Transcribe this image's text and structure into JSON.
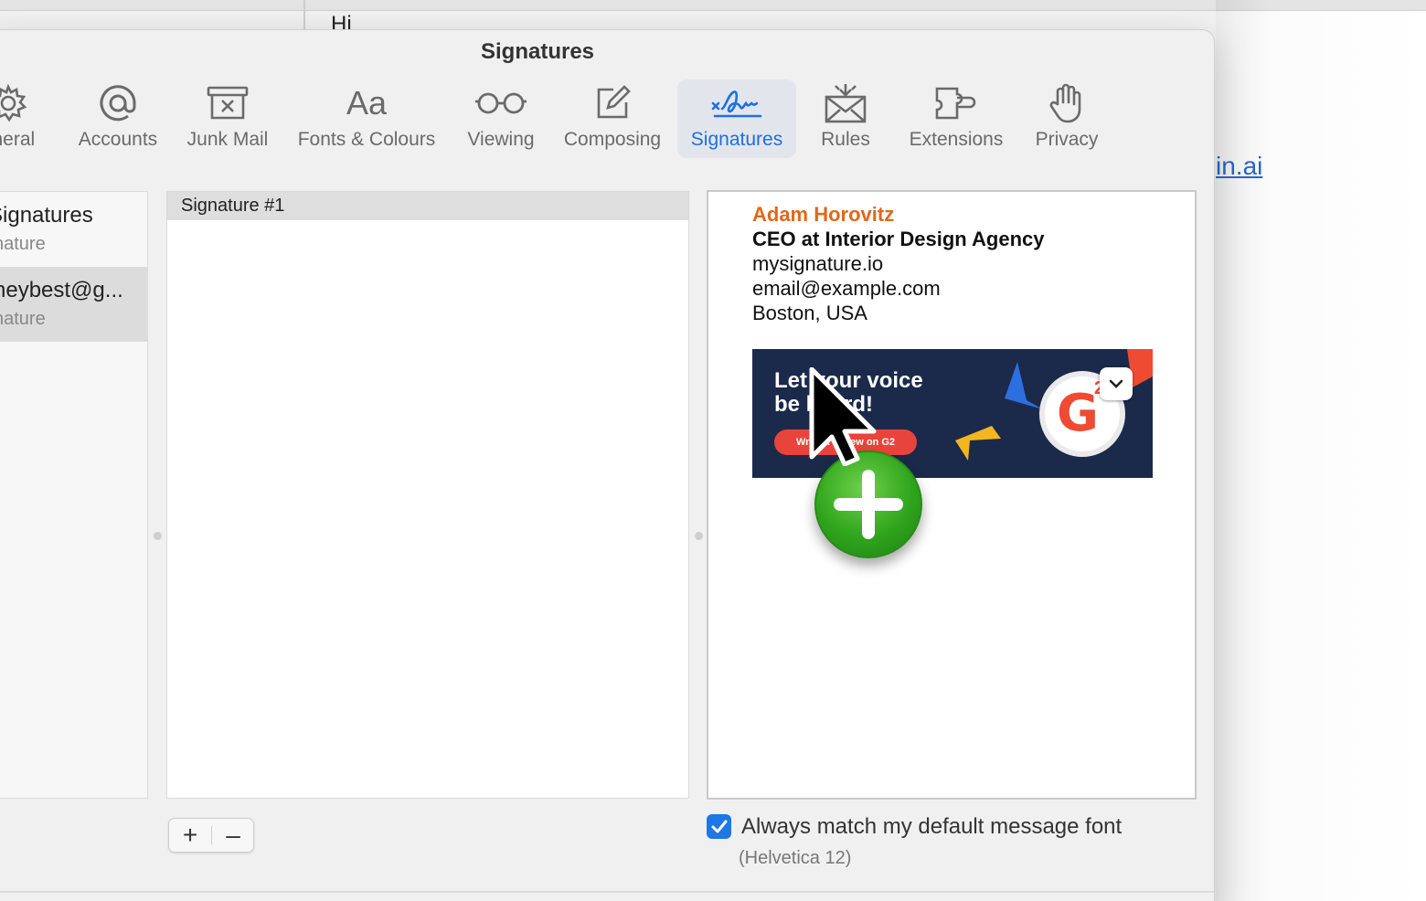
{
  "background": {
    "greeting_text": "Hi",
    "link_text": "in.ai"
  },
  "window": {
    "title": "Signatures"
  },
  "toolbar": {
    "items": [
      {
        "label": "eneral",
        "icon": "gear-icon"
      },
      {
        "label": "Accounts",
        "icon": "at-icon"
      },
      {
        "label": "Junk Mail",
        "icon": "junk-mail-icon"
      },
      {
        "label": "Fonts & Colours",
        "icon": "fonts-icon"
      },
      {
        "label": "Viewing",
        "icon": "glasses-icon"
      },
      {
        "label": "Composing",
        "icon": "compose-icon"
      },
      {
        "label": "Signatures",
        "icon": "signature-icon",
        "active": true
      },
      {
        "label": "Rules",
        "icon": "rules-icon"
      },
      {
        "label": "Extensions",
        "icon": "extensions-icon"
      },
      {
        "label": "Privacy",
        "icon": "hand-icon"
      }
    ],
    "active_color": "#1f6fe0"
  },
  "accounts": [
    {
      "name": "Signatures",
      "sub": "nature"
    },
    {
      "name": "neybest@g...",
      "sub": "nature",
      "selected": true
    }
  ],
  "signature_list": {
    "items": [
      "Signature #1"
    ]
  },
  "preview": {
    "name": "Adam Horovitz",
    "title": "CEO at Interior Design Agency",
    "website": "mysignature.io",
    "email": "email@example.com",
    "location": "Boston, USA",
    "banner": {
      "line1": "Let your voice",
      "line2": "be heard!",
      "button": "Write a review on G2",
      "badge_letter": "G",
      "badge_sup": "2"
    }
  },
  "controls": {
    "add_label": "+",
    "remove_label": "–",
    "checkbox_label": "Always match my default message font",
    "checkbox_checked": true,
    "font_note": "(Helvetica 12)"
  }
}
